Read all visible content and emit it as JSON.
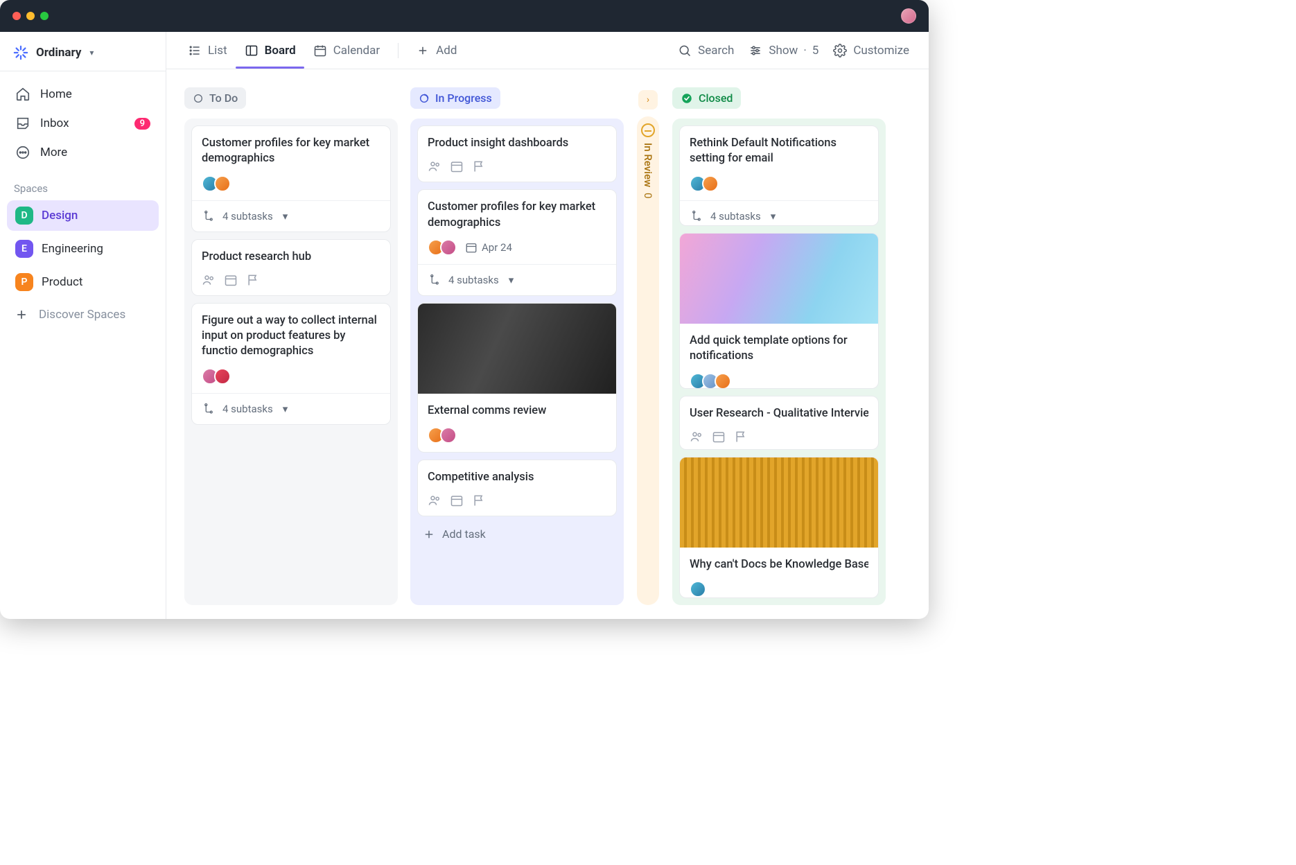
{
  "workspace": {
    "name": "Ordinary"
  },
  "nav": {
    "home": "Home",
    "inbox": "Inbox",
    "inbox_badge": "9",
    "more": "More",
    "section": "Spaces",
    "spaces": [
      {
        "letter": "D",
        "label": "Design"
      },
      {
        "letter": "E",
        "label": "Engineering"
      },
      {
        "letter": "P",
        "label": "Product"
      }
    ],
    "discover": "Discover Spaces"
  },
  "tabs": {
    "list": "List",
    "board": "Board",
    "calendar": "Calendar",
    "add": "Add"
  },
  "topbar": {
    "search": "Search",
    "show": "Show",
    "show_count": "5",
    "customize": "Customize"
  },
  "columns": {
    "todo": {
      "label": "To Do",
      "cards": [
        {
          "title": "Customer profiles for key market demographics",
          "subtasks": "4 subtasks"
        },
        {
          "title": "Product research hub"
        },
        {
          "title": "Figure out a way to collect internal input on product features by functio demographics",
          "subtasks": "4 subtasks"
        }
      ]
    },
    "in_progress": {
      "label": "In Progress",
      "add_task": "Add task",
      "cards": [
        {
          "title": "Product insight dashboards"
        },
        {
          "title": "Customer profiles for key market demographics",
          "date": "Apr 24",
          "subtasks": "4 subtasks"
        },
        {
          "title": "External comms review"
        },
        {
          "title": "Competitive analysis"
        }
      ]
    },
    "in_review": {
      "label": "In Review",
      "count": "0"
    },
    "closed": {
      "label": "Closed",
      "cards": [
        {
          "title": "Rethink Default Notifications setting for email",
          "subtasks": "4 subtasks"
        },
        {
          "title": "Add quick template options for notifications"
        },
        {
          "title": "User Research - Qualitative Interview"
        },
        {
          "title": "Why can't Docs be Knowledge Base"
        }
      ]
    }
  }
}
